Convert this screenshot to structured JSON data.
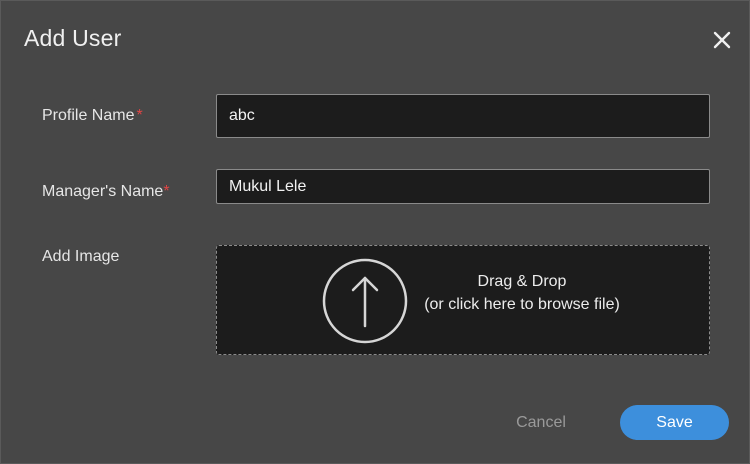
{
  "dialog": {
    "title": "Add User",
    "close_icon": "close-icon"
  },
  "form": {
    "profile_name": {
      "label": "Profile Name",
      "required_marker": "*",
      "value": "abc"
    },
    "manager_name": {
      "label": "Manager's Name",
      "required_marker": "*",
      "value": "Mukul Lele"
    },
    "add_image": {
      "label": "Add Image",
      "icon": "upload-arrow-icon",
      "drop_title": "Drag & Drop",
      "drop_subtitle": "(or click here to browse file)"
    }
  },
  "actions": {
    "cancel_label": "Cancel",
    "save_label": "Save"
  },
  "colors": {
    "dialog_bg": "#474747",
    "input_bg": "#1c1c1c",
    "accent": "#3d8fdc",
    "required": "#e04545"
  }
}
